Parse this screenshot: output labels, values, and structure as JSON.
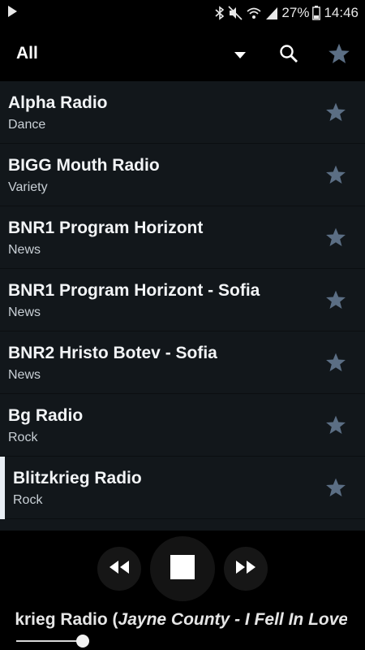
{
  "status_bar": {
    "battery": "27%",
    "time": "14:46"
  },
  "app_bar": {
    "filter": "All",
    "icons": [
      "chevron-down-icon",
      "search-icon",
      "star-icon"
    ]
  },
  "stations": [
    {
      "name": "Alpha Radio",
      "genre": "Dance"
    },
    {
      "name": "BIGG Mouth Radio",
      "genre": "Variety"
    },
    {
      "name": "BNR1 Program Horizont",
      "genre": "News"
    },
    {
      "name": "BNR1 Program Horizont - Sofia",
      "genre": "News"
    },
    {
      "name": "BNR2 Hristo Botev - Sofia",
      "genre": "News"
    },
    {
      "name": "Bg Radio",
      "genre": "Rock"
    },
    {
      "name": "Blitzkrieg Radio",
      "genre": "Rock"
    }
  ],
  "player": {
    "now_playing_prefix": "Blitzkrieg Radio (",
    "now_playing_track": "Jayne County - I Fell In Love With",
    "icons": [
      "rewind-icon",
      "stop-icon",
      "fast-forward-icon"
    ]
  },
  "colors": {
    "list_bg": "#12171b",
    "star": "#5b6e84",
    "active_indicator": "#e8eef4"
  }
}
